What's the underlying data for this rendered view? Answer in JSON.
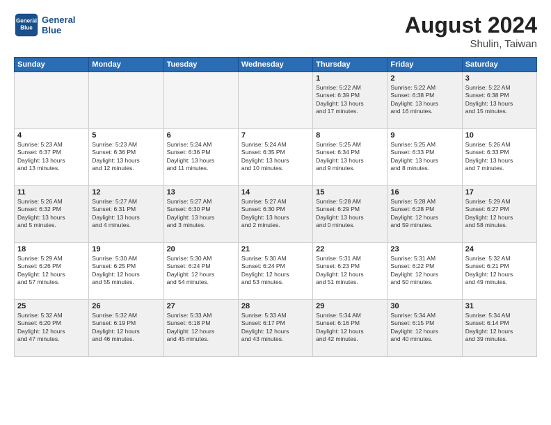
{
  "header": {
    "logo_line1": "General",
    "logo_line2": "Blue",
    "month_year": "August 2024",
    "location": "Shulin, Taiwan"
  },
  "days_of_week": [
    "Sunday",
    "Monday",
    "Tuesday",
    "Wednesday",
    "Thursday",
    "Friday",
    "Saturday"
  ],
  "weeks": [
    [
      {
        "day": "",
        "info": "",
        "empty": true
      },
      {
        "day": "",
        "info": "",
        "empty": true
      },
      {
        "day": "",
        "info": "",
        "empty": true
      },
      {
        "day": "",
        "info": "",
        "empty": true
      },
      {
        "day": "1",
        "info": "Sunrise: 5:22 AM\nSunset: 6:39 PM\nDaylight: 13 hours\nand 17 minutes."
      },
      {
        "day": "2",
        "info": "Sunrise: 5:22 AM\nSunset: 6:38 PM\nDaylight: 13 hours\nand 16 minutes."
      },
      {
        "day": "3",
        "info": "Sunrise: 5:22 AM\nSunset: 6:38 PM\nDaylight: 13 hours\nand 15 minutes."
      }
    ],
    [
      {
        "day": "4",
        "info": "Sunrise: 5:23 AM\nSunset: 6:37 PM\nDaylight: 13 hours\nand 13 minutes."
      },
      {
        "day": "5",
        "info": "Sunrise: 5:23 AM\nSunset: 6:36 PM\nDaylight: 13 hours\nand 12 minutes."
      },
      {
        "day": "6",
        "info": "Sunrise: 5:24 AM\nSunset: 6:36 PM\nDaylight: 13 hours\nand 11 minutes."
      },
      {
        "day": "7",
        "info": "Sunrise: 5:24 AM\nSunset: 6:35 PM\nDaylight: 13 hours\nand 10 minutes."
      },
      {
        "day": "8",
        "info": "Sunrise: 5:25 AM\nSunset: 6:34 PM\nDaylight: 13 hours\nand 9 minutes."
      },
      {
        "day": "9",
        "info": "Sunrise: 5:25 AM\nSunset: 6:33 PM\nDaylight: 13 hours\nand 8 minutes."
      },
      {
        "day": "10",
        "info": "Sunrise: 5:26 AM\nSunset: 6:33 PM\nDaylight: 13 hours\nand 7 minutes."
      }
    ],
    [
      {
        "day": "11",
        "info": "Sunrise: 5:26 AM\nSunset: 6:32 PM\nDaylight: 13 hours\nand 5 minutes."
      },
      {
        "day": "12",
        "info": "Sunrise: 5:27 AM\nSunset: 6:31 PM\nDaylight: 13 hours\nand 4 minutes."
      },
      {
        "day": "13",
        "info": "Sunrise: 5:27 AM\nSunset: 6:30 PM\nDaylight: 13 hours\nand 3 minutes."
      },
      {
        "day": "14",
        "info": "Sunrise: 5:27 AM\nSunset: 6:30 PM\nDaylight: 13 hours\nand 2 minutes."
      },
      {
        "day": "15",
        "info": "Sunrise: 5:28 AM\nSunset: 6:29 PM\nDaylight: 13 hours\nand 0 minutes."
      },
      {
        "day": "16",
        "info": "Sunrise: 5:28 AM\nSunset: 6:28 PM\nDaylight: 12 hours\nand 59 minutes."
      },
      {
        "day": "17",
        "info": "Sunrise: 5:29 AM\nSunset: 6:27 PM\nDaylight: 12 hours\nand 58 minutes."
      }
    ],
    [
      {
        "day": "18",
        "info": "Sunrise: 5:29 AM\nSunset: 6:26 PM\nDaylight: 12 hours\nand 57 minutes."
      },
      {
        "day": "19",
        "info": "Sunrise: 5:30 AM\nSunset: 6:25 PM\nDaylight: 12 hours\nand 55 minutes."
      },
      {
        "day": "20",
        "info": "Sunrise: 5:30 AM\nSunset: 6:24 PM\nDaylight: 12 hours\nand 54 minutes."
      },
      {
        "day": "21",
        "info": "Sunrise: 5:30 AM\nSunset: 6:24 PM\nDaylight: 12 hours\nand 53 minutes."
      },
      {
        "day": "22",
        "info": "Sunrise: 5:31 AM\nSunset: 6:23 PM\nDaylight: 12 hours\nand 51 minutes."
      },
      {
        "day": "23",
        "info": "Sunrise: 5:31 AM\nSunset: 6:22 PM\nDaylight: 12 hours\nand 50 minutes."
      },
      {
        "day": "24",
        "info": "Sunrise: 5:32 AM\nSunset: 6:21 PM\nDaylight: 12 hours\nand 49 minutes."
      }
    ],
    [
      {
        "day": "25",
        "info": "Sunrise: 5:32 AM\nSunset: 6:20 PM\nDaylight: 12 hours\nand 47 minutes."
      },
      {
        "day": "26",
        "info": "Sunrise: 5:32 AM\nSunset: 6:19 PM\nDaylight: 12 hours\nand 46 minutes."
      },
      {
        "day": "27",
        "info": "Sunrise: 5:33 AM\nSunset: 6:18 PM\nDaylight: 12 hours\nand 45 minutes."
      },
      {
        "day": "28",
        "info": "Sunrise: 5:33 AM\nSunset: 6:17 PM\nDaylight: 12 hours\nand 43 minutes."
      },
      {
        "day": "29",
        "info": "Sunrise: 5:34 AM\nSunset: 6:16 PM\nDaylight: 12 hours\nand 42 minutes."
      },
      {
        "day": "30",
        "info": "Sunrise: 5:34 AM\nSunset: 6:15 PM\nDaylight: 12 hours\nand 40 minutes."
      },
      {
        "day": "31",
        "info": "Sunrise: 5:34 AM\nSunset: 6:14 PM\nDaylight: 12 hours\nand 39 minutes."
      }
    ]
  ]
}
